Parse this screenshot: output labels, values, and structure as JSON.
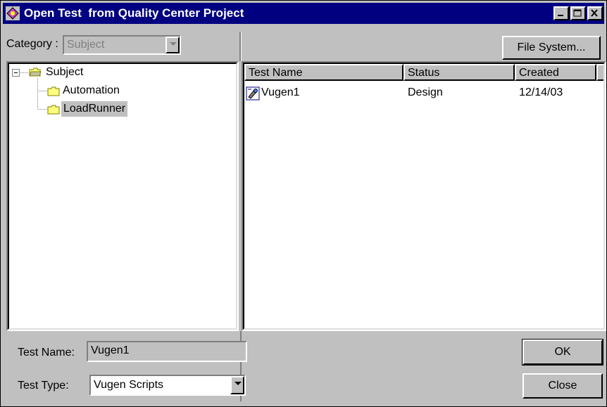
{
  "window": {
    "title": "Open Test  from Quality Center Project"
  },
  "category": {
    "label": "Category :",
    "value": "Subject"
  },
  "toolbar": {
    "file_system_label": "File System..."
  },
  "tree": {
    "root": "Subject",
    "children": [
      "Automation",
      "LoadRunner"
    ],
    "selected": "LoadRunner"
  },
  "table": {
    "columns": [
      "Test Name",
      "Status",
      "Created"
    ],
    "rows": [
      {
        "name": "Vugen1",
        "status": "Design",
        "created": "12/14/03",
        "icon": "vugen-script-icon"
      }
    ]
  },
  "form": {
    "test_name_label": "Test Name:",
    "test_name_value": "Vugen1",
    "test_type_label": "Test Type:",
    "test_type_value": "Vugen Scripts"
  },
  "buttons": {
    "ok": "OK",
    "close": "Close"
  },
  "colors": {
    "titlebar": "#000080",
    "selection": "#c0c0c0",
    "folder": "#ffff80"
  }
}
